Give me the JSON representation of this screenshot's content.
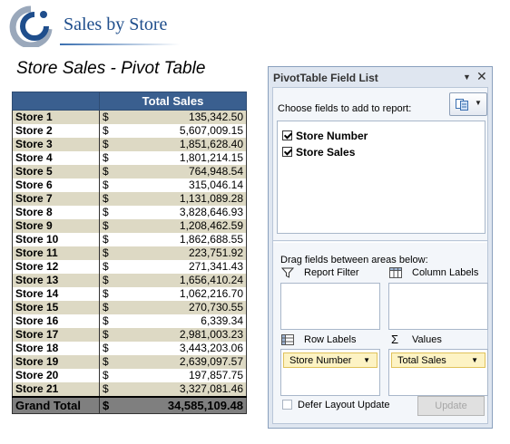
{
  "header": {
    "logo_text": "Sales by Store"
  },
  "page_title": "Store Sales - Pivot Table",
  "pivot": {
    "header_value": "Total Sales",
    "currency": "$",
    "rows": [
      {
        "label": "Store 1",
        "value": "135,342.50"
      },
      {
        "label": "Store 2",
        "value": "5,607,009.15"
      },
      {
        "label": "Store 3",
        "value": "1,851,628.40"
      },
      {
        "label": "Store 4",
        "value": "1,801,214.15"
      },
      {
        "label": "Store 5",
        "value": "764,948.54"
      },
      {
        "label": "Store 6",
        "value": "315,046.14"
      },
      {
        "label": "Store 7",
        "value": "1,131,089.28"
      },
      {
        "label": "Store 8",
        "value": "3,828,646.93"
      },
      {
        "label": "Store 9",
        "value": "1,208,462.59"
      },
      {
        "label": "Store 10",
        "value": "1,862,688.55"
      },
      {
        "label": "Store 11",
        "value": "223,751.92"
      },
      {
        "label": "Store 12",
        "value": "271,341.43"
      },
      {
        "label": "Store 13",
        "value": "1,656,410.24"
      },
      {
        "label": "Store 14",
        "value": "1,062,216.70"
      },
      {
        "label": "Store 15",
        "value": "270,730.55"
      },
      {
        "label": "Store 16",
        "value": "6,339.34"
      },
      {
        "label": "Store 17",
        "value": "2,981,003.23"
      },
      {
        "label": "Store 18",
        "value": "3,443,203.06"
      },
      {
        "label": "Store 19",
        "value": "2,639,097.57"
      },
      {
        "label": "Store 20",
        "value": "197,857.75"
      },
      {
        "label": "Store 21",
        "value": "3,327,081.46"
      }
    ],
    "total": {
      "label": "Grand Total",
      "value": "34,585,109.48"
    }
  },
  "field_list": {
    "title": "PivotTable Field List",
    "choose_label": "Choose fields to add to report:",
    "fields": [
      {
        "label": "Store Number",
        "checked": true
      },
      {
        "label": "Store Sales",
        "checked": true
      }
    ],
    "drag_label": "Drag fields between areas below:",
    "areas": {
      "report_filter": "Report Filter",
      "column_labels": "Column Labels",
      "row_labels": "Row Labels",
      "values": "Values"
    },
    "row_chip": "Store Number",
    "value_chip": "Total Sales",
    "defer_label": "Defer Layout Update",
    "update_label": "Update"
  }
}
